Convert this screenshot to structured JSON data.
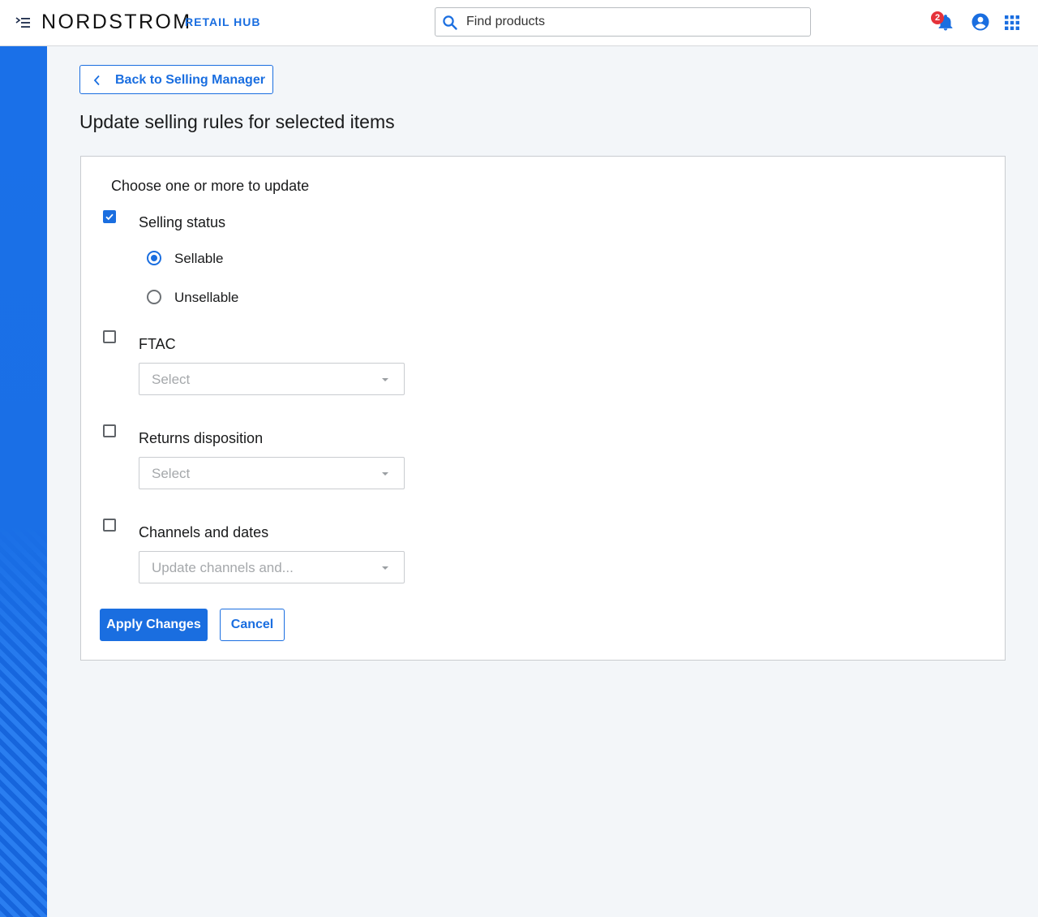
{
  "header": {
    "brand": "NORDSTROM",
    "product": "RETAIL HUB",
    "search_placeholder": "Find products",
    "notification_count": "2",
    "icons": [
      "menu-toggle-icon",
      "search-icon",
      "bell-icon",
      "user-account-icon",
      "apps-grid-icon"
    ]
  },
  "colors": {
    "accent": "#1a6ee0",
    "sidebar": "#1a6fe6",
    "badge": "#e5323a"
  },
  "main": {
    "back_label": "Back to Selling Manager",
    "page_title": "Update selling rules for selected items",
    "form": {
      "heading": "Choose one or more to update",
      "selling_status": {
        "label": "Selling status",
        "checked": true,
        "options": [
          {
            "label": "Sellable",
            "selected": true
          },
          {
            "label": "Unsellable",
            "selected": false
          }
        ]
      },
      "ftac": {
        "label": "FTAC",
        "checked": false,
        "placeholder": "Select"
      },
      "returns": {
        "label": "Returns disposition",
        "checked": false,
        "placeholder": "Select"
      },
      "channels": {
        "label": "Channels and dates",
        "checked": false,
        "placeholder": "Update channels and..."
      },
      "apply_label": "Apply Changes",
      "cancel_label": "Cancel"
    }
  }
}
